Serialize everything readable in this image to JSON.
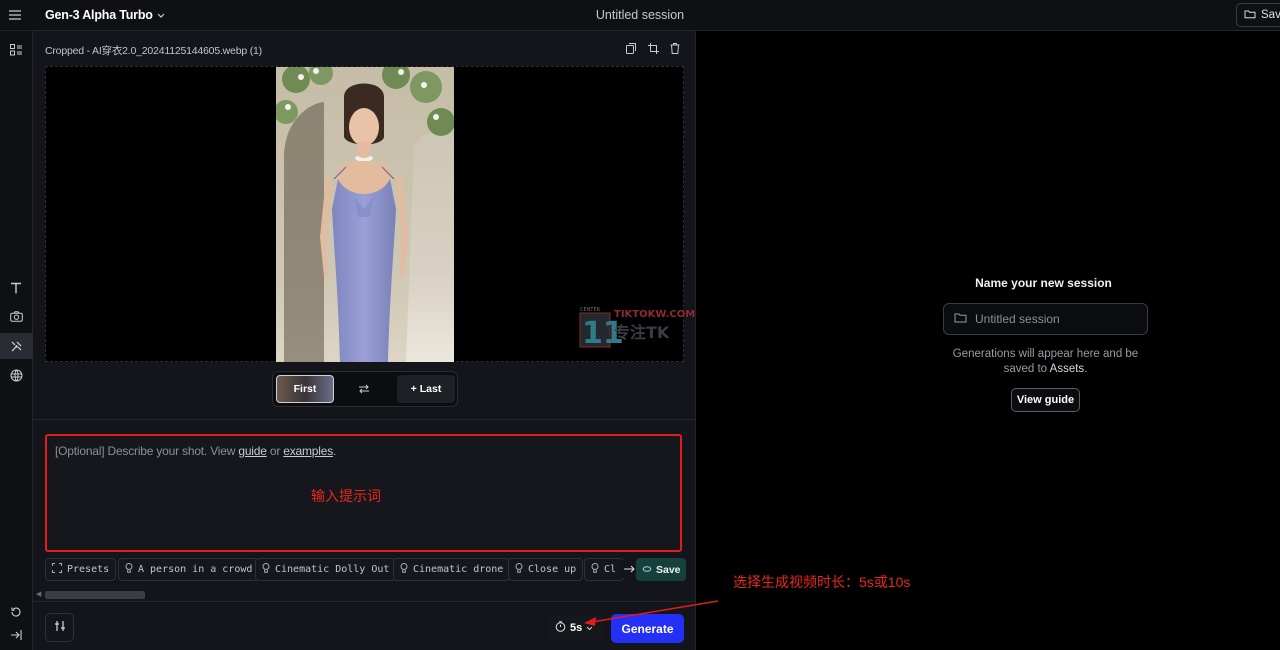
{
  "topbar": {
    "model_name": "Gen-3 Alpha Turbo",
    "session_title": "Untitled session",
    "save_label": "Save"
  },
  "sidebar": {
    "icons": [
      "apps-icon",
      "text-icon",
      "camera-icon",
      "tools-icon",
      "globe-icon",
      "history-icon",
      "collapse-icon"
    ]
  },
  "panel": {
    "file_name": "Cropped - AI穿衣2.0_20241125144605.webp (1)",
    "first_label": "First",
    "last_label": "+ Last",
    "prompt": {
      "placeholder_prefix": "[Optional] Describe your shot. View ",
      "guide_link": "guide",
      "or_text": " or ",
      "examples_link": "examples",
      "suffix": ".",
      "annotation": "输入提示词"
    },
    "presets": {
      "presets_label": "Presets",
      "chips": [
        "A person in a crowd",
        "Cinematic Dolly Out",
        "Cinematic drone",
        "Close up",
        "Cl"
      ],
      "save_label": "Save"
    },
    "duration": "5s",
    "generate_label": "Generate"
  },
  "watermark": {
    "top_text": "TIKTOKW.COM",
    "big_number": "11",
    "sub_text": "专注TK"
  },
  "session_panel": {
    "title": "Name your new session",
    "input_placeholder": "Untitled session",
    "info_line1": "Generations will appear here and be",
    "info_line2_prefix": "saved to ",
    "info_assets": "Assets",
    "info_line2_suffix": ".",
    "guide_button": "View guide"
  },
  "annotation": {
    "duration_note": "选择生成视频时长：5s或10s",
    "color": "#e8281e"
  },
  "colors": {
    "generate": "#2430f5",
    "save_chip": "#173f3b",
    "annotation_red": "#e01e1e"
  }
}
